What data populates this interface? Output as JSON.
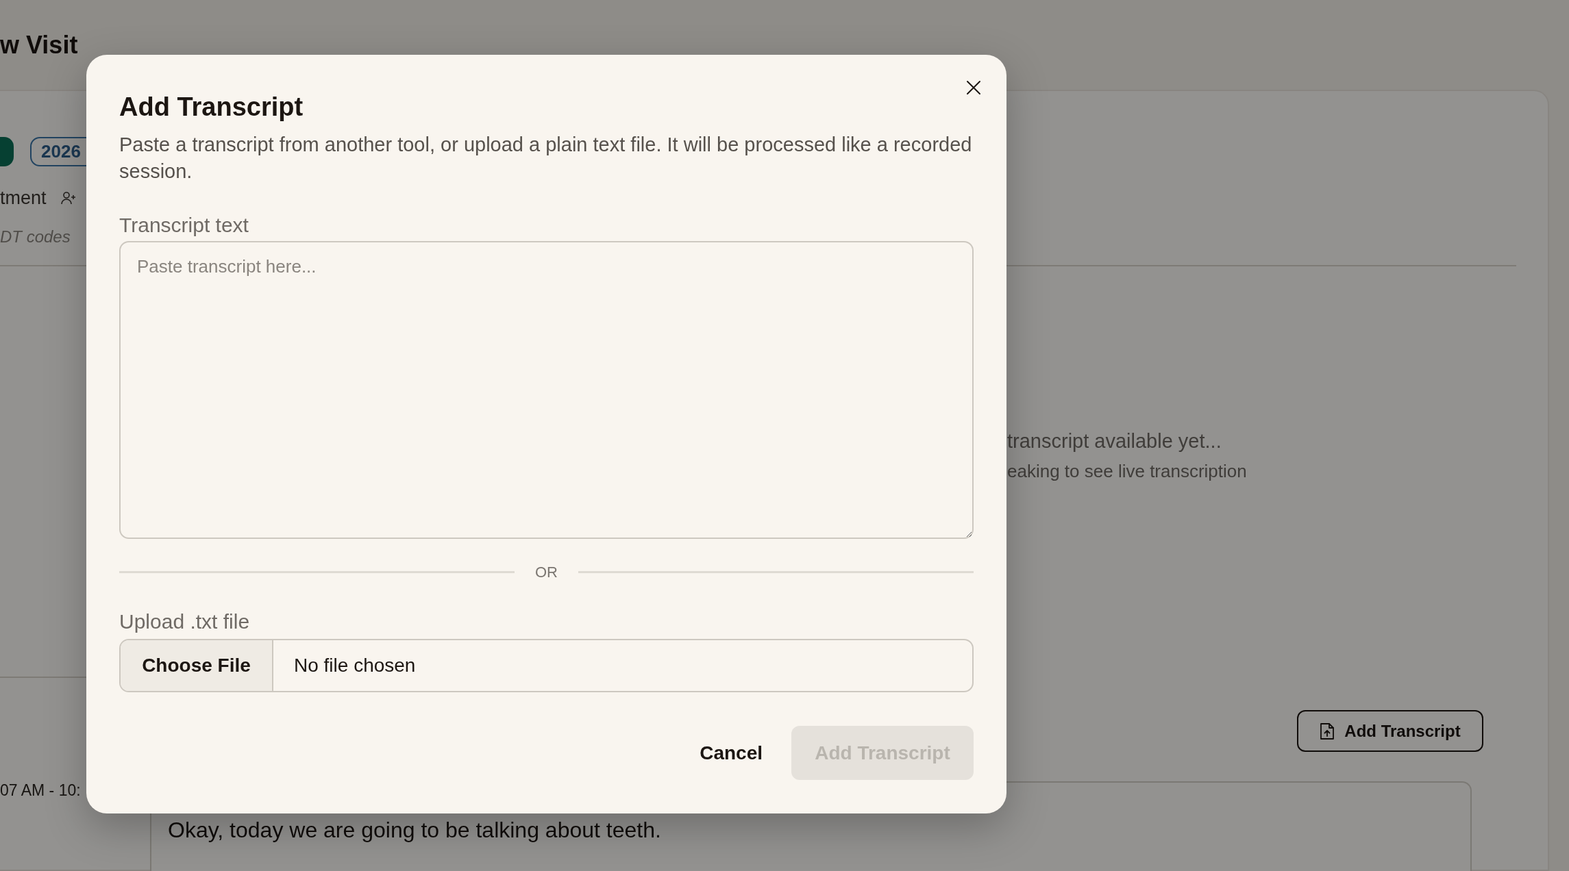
{
  "background": {
    "page_title": "w Visit",
    "badges": [
      {
        "kind": "filled"
      },
      {
        "kind": "outline",
        "text": "2026"
      }
    ],
    "visit_type": "tment",
    "codes_hint": "DT codes",
    "time_range": "07 AM - 10:",
    "empty_state": {
      "title": "transcript available yet...",
      "subtitle": "eaking to see live transcription"
    },
    "add_transcript_button": "Add Transcript",
    "transcript_entries": [
      {
        "text": "Okay, today we are going to be talking about teeth."
      }
    ]
  },
  "modal": {
    "title": "Add Transcript",
    "description": "Paste a transcript from another tool, or upload a plain text file. It will be processed like a recorded session.",
    "textarea": {
      "label": "Transcript text",
      "placeholder": "Paste transcript here..."
    },
    "divider_label": "OR",
    "upload": {
      "label": "Upload .txt file",
      "button": "Choose File",
      "file_name": "No file chosen"
    },
    "cancel_button": "Cancel",
    "submit_button": {
      "label": "Add Transcript",
      "disabled": true
    }
  }
}
